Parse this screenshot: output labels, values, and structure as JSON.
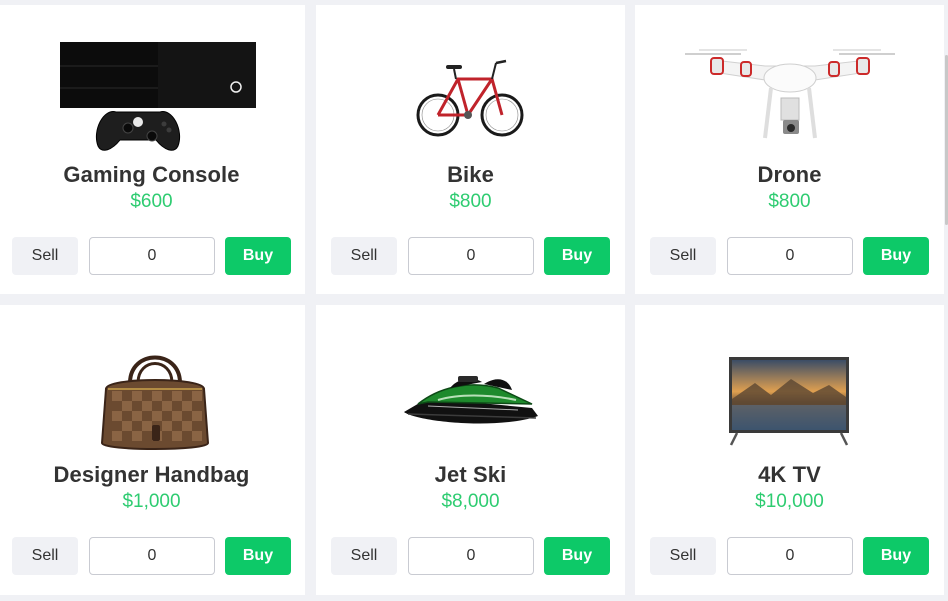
{
  "products": [
    {
      "name": "Gaming Console",
      "price": "$600",
      "quantity": "0",
      "sell_label": "Sell",
      "buy_label": "Buy",
      "image": "gaming-console-image"
    },
    {
      "name": "Bike",
      "price": "$800",
      "quantity": "0",
      "sell_label": "Sell",
      "buy_label": "Buy",
      "image": "bike-image"
    },
    {
      "name": "Drone",
      "price": "$800",
      "quantity": "0",
      "sell_label": "Sell",
      "buy_label": "Buy",
      "image": "drone-image"
    },
    {
      "name": "Designer Handbag",
      "price": "$1,000",
      "quantity": "0",
      "sell_label": "Sell",
      "buy_label": "Buy",
      "image": "handbag-image"
    },
    {
      "name": "Jet Ski",
      "price": "$8,000",
      "quantity": "0",
      "sell_label": "Sell",
      "buy_label": "Buy",
      "image": "jet-ski-image"
    },
    {
      "name": "4K TV",
      "price": "$10,000",
      "quantity": "0",
      "sell_label": "Sell",
      "buy_label": "Buy",
      "image": "tv-image"
    }
  ],
  "colors": {
    "page_background": "#f0f1f5",
    "card_background": "#ffffff",
    "price_green": "#2ecc71",
    "buy_green": "#0dc968",
    "sell_gray": "#f0f1f5",
    "text_dark": "#333333"
  }
}
